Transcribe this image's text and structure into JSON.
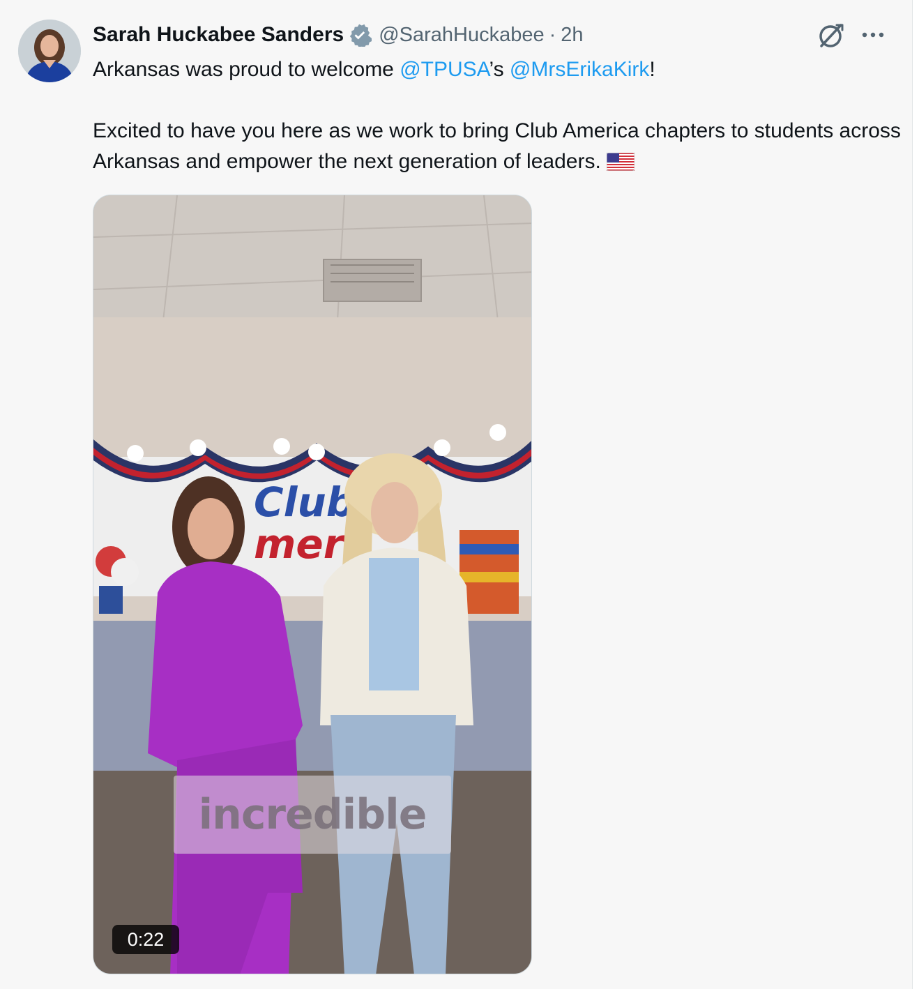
{
  "tweet": {
    "author": {
      "display_name": "Sarah Huckabee Sanders",
      "handle": "@SarahHuckabee",
      "verified": true,
      "avatar_icon": "avatar"
    },
    "separator": "·",
    "timestamp": "2h",
    "text": {
      "line1_prefix": "Arkansas was proud to welcome ",
      "mention1": "@TPUSA",
      "line1_mid": "’s ",
      "mention2": "@MrsErikaKirk",
      "line1_suffix": "!",
      "paragraph2": "Excited to have you here as we work to bring Club America chapters to students across Arkansas and empower the next generation of leaders.",
      "emoji": "us-flag"
    },
    "media": {
      "type": "video",
      "caption_overlay": "incredible",
      "duration": "0:22"
    },
    "actions": {
      "grok_icon": "grok-icon",
      "more_icon": "more-icon"
    }
  },
  "colors": {
    "background": "#f7f7f7",
    "text": "#0f1419",
    "secondary_text": "#536471",
    "mention": "#1d9bf0",
    "verified_badge": "#829aab"
  }
}
